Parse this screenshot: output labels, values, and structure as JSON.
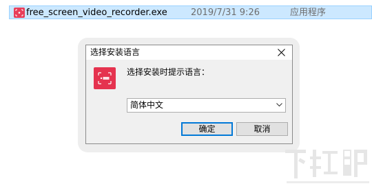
{
  "file": {
    "name": "free_screen_video_recorder.exe",
    "date": "2019/7/31 9:26",
    "type": "应用程序",
    "icon": "recorder-app-icon"
  },
  "dialog": {
    "title": "选择安装语言",
    "prompt": "选择安装时提示语言：",
    "language_select": {
      "selected": "简体中文"
    },
    "ok_label": "确定",
    "cancel_label": "取消",
    "icon": "recorder-app-icon",
    "accent_color": "#e5334f"
  },
  "watermark": {
    "text": "下载吧"
  }
}
